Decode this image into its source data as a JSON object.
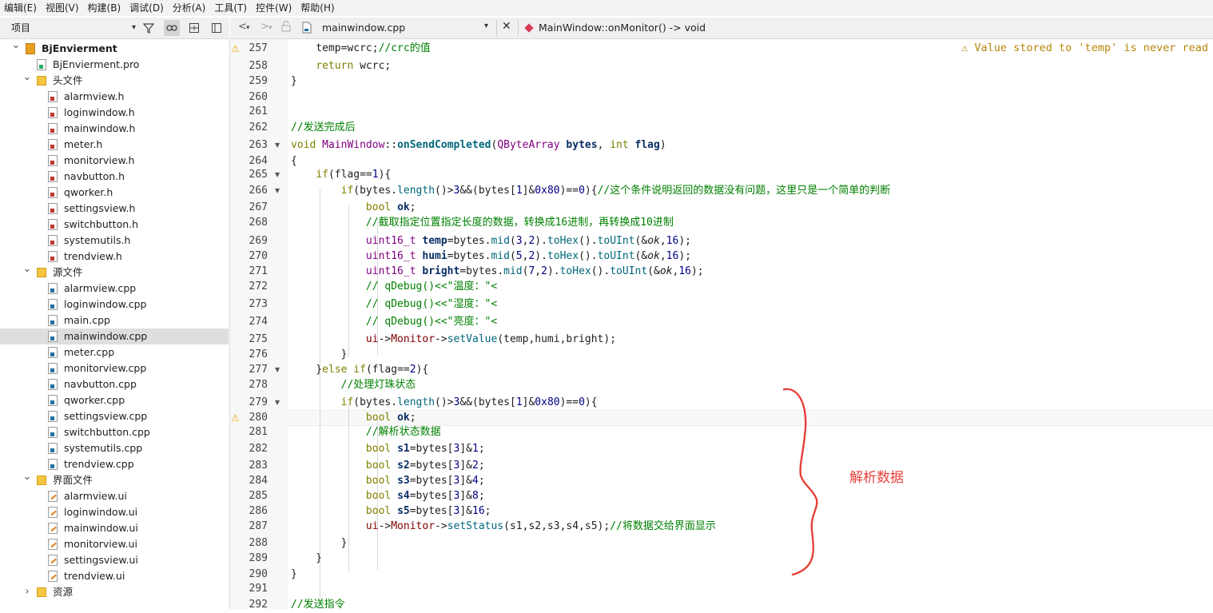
{
  "menu": [
    "编辑(E)",
    "视图(V)",
    "构建(B)",
    "调试(D)",
    "分析(A)",
    "工具(T)",
    "控件(W)",
    "帮助(H)"
  ],
  "sidebar": {
    "combo_label": "项目",
    "tree": [
      {
        "label": "BjEnvierment",
        "kind": "project",
        "depth": 0,
        "expanded": true,
        "bold": true
      },
      {
        "label": "BjEnvierment.pro",
        "kind": "pro",
        "depth": 1
      },
      {
        "label": "头文件",
        "kind": "folder",
        "depth": 1,
        "expanded": true
      },
      {
        "label": "alarmview.h",
        "kind": "h",
        "depth": 2
      },
      {
        "label": "loginwindow.h",
        "kind": "h",
        "depth": 2
      },
      {
        "label": "mainwindow.h",
        "kind": "h",
        "depth": 2
      },
      {
        "label": "meter.h",
        "kind": "h",
        "depth": 2
      },
      {
        "label": "monitorview.h",
        "kind": "h",
        "depth": 2
      },
      {
        "label": "navbutton.h",
        "kind": "h",
        "depth": 2
      },
      {
        "label": "qworker.h",
        "kind": "h",
        "depth": 2
      },
      {
        "label": "settingsview.h",
        "kind": "h",
        "depth": 2
      },
      {
        "label": "switchbutton.h",
        "kind": "h",
        "depth": 2
      },
      {
        "label": "systemutils.h",
        "kind": "h",
        "depth": 2
      },
      {
        "label": "trendview.h",
        "kind": "h",
        "depth": 2
      },
      {
        "label": "源文件",
        "kind": "folder",
        "depth": 1,
        "expanded": true
      },
      {
        "label": "alarmview.cpp",
        "kind": "cpp",
        "depth": 2
      },
      {
        "label": "loginwindow.cpp",
        "kind": "cpp",
        "depth": 2
      },
      {
        "label": "main.cpp",
        "kind": "cpp",
        "depth": 2
      },
      {
        "label": "mainwindow.cpp",
        "kind": "cpp",
        "depth": 2,
        "selected": true
      },
      {
        "label": "meter.cpp",
        "kind": "cpp",
        "depth": 2
      },
      {
        "label": "monitorview.cpp",
        "kind": "cpp",
        "depth": 2
      },
      {
        "label": "navbutton.cpp",
        "kind": "cpp",
        "depth": 2
      },
      {
        "label": "qworker.cpp",
        "kind": "cpp",
        "depth": 2
      },
      {
        "label": "settingsview.cpp",
        "kind": "cpp",
        "depth": 2
      },
      {
        "label": "switchbutton.cpp",
        "kind": "cpp",
        "depth": 2
      },
      {
        "label": "systemutils.cpp",
        "kind": "cpp",
        "depth": 2
      },
      {
        "label": "trendview.cpp",
        "kind": "cpp",
        "depth": 2
      },
      {
        "label": "界面文件",
        "kind": "folder-ui",
        "depth": 1,
        "expanded": true
      },
      {
        "label": "alarmview.ui",
        "kind": "ui",
        "depth": 2
      },
      {
        "label": "loginwindow.ui",
        "kind": "ui",
        "depth": 2
      },
      {
        "label": "mainwindow.ui",
        "kind": "ui",
        "depth": 2
      },
      {
        "label": "monitorview.ui",
        "kind": "ui",
        "depth": 2
      },
      {
        "label": "settingsview.ui",
        "kind": "ui",
        "depth": 2
      },
      {
        "label": "trendview.ui",
        "kind": "ui",
        "depth": 2
      },
      {
        "label": "资源",
        "kind": "folder-res",
        "depth": 1,
        "expanded": false
      }
    ]
  },
  "editor": {
    "file_tab": "mainwindow.cpp",
    "function_nav": "MainWindow::onMonitor() -> void",
    "warning_message": "Value stored to 'temp' is never read",
    "annotation": "解析数据",
    "lines": [
      {
        "n": "257",
        "warn": true,
        "html": "    temp=wcrc;<span class=\"cm\">//crc的值</span>"
      },
      {
        "n": "258",
        "html": "    <span class=\"kw\">return</span> wcrc;"
      },
      {
        "n": "259",
        "html": "}"
      },
      {
        "n": "260",
        "html": ""
      },
      {
        "n": "261",
        "html": ""
      },
      {
        "n": "262",
        "html": "<span class=\"cm\">//发送完成后</span>"
      },
      {
        "n": "263",
        "fold": true,
        "html": "<span class=\"kw\">void</span> <span class=\"ty\">MainWindow</span>::<span class=\"bd\" style=\"color:#00677c\">onSendCompleted</span>(<span class=\"ty\">QByteArray</span> <span class=\"bd\">bytes</span>, <span class=\"kw\">int</span> <span class=\"bd\">flag</span>)"
      },
      {
        "n": "264",
        "html": "{"
      },
      {
        "n": "265",
        "fold": true,
        "html": "    <span class=\"kw\">if</span>(flag==<span class=\"num\">1</span>){"
      },
      {
        "n": "266",
        "fold": true,
        "html": "        <span class=\"kw\">if</span>(bytes.<span class=\"mt\">length</span>()><span class=\"num\">3</span>&&(bytes[<span class=\"num\">1</span>]&<span class=\"num\">0x80</span>)==<span class=\"num\">0</span>){<span class=\"cm\">//这个条件说明返回的数据没有问题，这里只是一个简单的判断</span>"
      },
      {
        "n": "267",
        "html": "            <span class=\"kw\">bool</span> <span class=\"bd\">ok</span>;"
      },
      {
        "n": "268",
        "html": "            <span class=\"cm\">//截取指定位置指定长度的数据，转换成16进制，再转换成10进制</span>"
      },
      {
        "n": "269",
        "html": "            <span class=\"ty\">uint16_t</span> <span class=\"bd\">temp</span>=bytes.<span class=\"mt\">mid</span>(<span class=\"num\">3</span>,<span class=\"num\">2</span>).<span class=\"mt\">toHex</span>().<span class=\"mt\">toUInt</span>(&<i>ok</i>,<span class=\"num\">16</span>);"
      },
      {
        "n": "270",
        "html": "            <span class=\"ty\">uint16_t</span> <span class=\"bd\">humi</span>=bytes.<span class=\"mt\">mid</span>(<span class=\"num\">5</span>,<span class=\"num\">2</span>).<span class=\"mt\">toHex</span>().<span class=\"mt\">toUInt</span>(&<i>ok</i>,<span class=\"num\">16</span>);"
      },
      {
        "n": "271",
        "html": "            <span class=\"ty\">uint16_t</span> <span class=\"bd\">bright</span>=bytes.<span class=\"mt\">mid</span>(<span class=\"num\">7</span>,<span class=\"num\">2</span>).<span class=\"mt\">toHex</span>().<span class=\"mt\">toUInt</span>(&<i>ok</i>,<span class=\"num\">16</span>);"
      },
      {
        "n": "272",
        "html": "            <span class=\"cm\">// qDebug()<<\"温度：\"<<temp;</span>"
      },
      {
        "n": "273",
        "html": "            <span class=\"cm\">// qDebug()<<\"湿度：\"<<humi;</span>"
      },
      {
        "n": "274",
        "html": "            <span class=\"cm\">// qDebug()<<\"亮度：\"<<bright;</span>"
      },
      {
        "n": "275",
        "html": "            <span class=\"inl\">ui</span>-><span class=\"inl\">Monitor</span>-><span class=\"mt\">setValue</span>(temp,humi,bright);"
      },
      {
        "n": "276",
        "html": "        }"
      },
      {
        "n": "277",
        "fold": true,
        "html": "    }<span class=\"kw\">else</span> <span class=\"kw\">if</span>(flag==<span class=\"num\">2</span>){"
      },
      {
        "n": "278",
        "html": "        <span class=\"cm\">//处理灯珠状态</span>"
      },
      {
        "n": "279",
        "fold": true,
        "html": "        <span class=\"kw\">if</span>(bytes.<span class=\"mt\">length</span>()><span class=\"num\">3</span>&&(bytes[<span class=\"num\">1</span>]&<span class=\"num\">0x80</span>)==<span class=\"num\">0</span>){"
      },
      {
        "n": "280",
        "warn": true,
        "current": true,
        "html": "            <span class=\"kw\">bool</span> <span class=\"bd\">ok</span>;"
      },
      {
        "n": "281",
        "html": "            <span class=\"cm\">//解析状态数据</span>"
      },
      {
        "n": "282",
        "html": "            <span class=\"kw\">bool</span> <span class=\"bd\">s1</span>=bytes[<span class=\"num\">3</span>]&<span class=\"num\">1</span>;"
      },
      {
        "n": "283",
        "html": "            <span class=\"kw\">bool</span> <span class=\"bd\">s2</span>=bytes[<span class=\"num\">3</span>]&<span class=\"num\">2</span>;"
      },
      {
        "n": "284",
        "html": "            <span class=\"kw\">bool</span> <span class=\"bd\">s3</span>=bytes[<span class=\"num\">3</span>]&<span class=\"num\">4</span>;"
      },
      {
        "n": "285",
        "html": "            <span class=\"kw\">bool</span> <span class=\"bd\">s4</span>=bytes[<span class=\"num\">3</span>]&<span class=\"num\">8</span>;"
      },
      {
        "n": "286",
        "html": "            <span class=\"kw\">bool</span> <span class=\"bd\">s5</span>=bytes[<span class=\"num\">3</span>]&<span class=\"num\">16</span>;"
      },
      {
        "n": "287",
        "html": "            <span class=\"inl\">ui</span>-><span class=\"inl\">Monitor</span>-><span class=\"mt\">setStatus</span>(s1,s2,s3,s4,s5);<span class=\"cm\">//将数据交给界面显示</span>"
      },
      {
        "n": "288",
        "html": "        }"
      },
      {
        "n": "289",
        "html": "    }"
      },
      {
        "n": "290",
        "html": "}"
      },
      {
        "n": "291",
        "html": ""
      },
      {
        "n": "292",
        "html": "<span class=\"cm\">//发送指令</span>"
      }
    ]
  }
}
